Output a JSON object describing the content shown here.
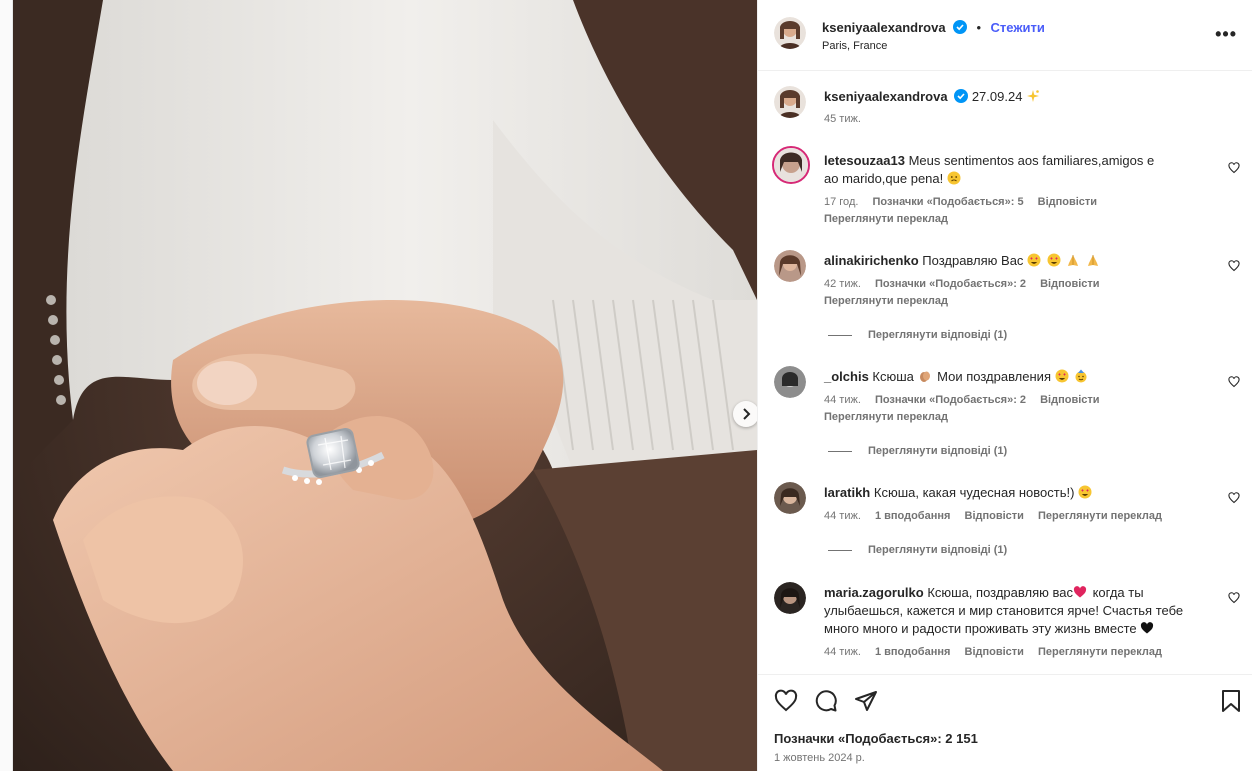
{
  "post": {
    "author": "kseniyaalexandrova",
    "follow_label": "Стежити",
    "separator": "•",
    "location": "Paris, France",
    "more_label": "•••"
  },
  "caption": {
    "author": "kseniyaalexandrova",
    "text": "27.09.24",
    "time": "45 тиж."
  },
  "comments": [
    {
      "user": "letesouzaa13",
      "text": "Meus sentimentos aos familiares,amigos e ao marido,que pena!",
      "time": "17 год.",
      "likes": "Позначки «Подобається»: 5",
      "reply": "Відповісти",
      "translate": "Переглянути переклад"
    },
    {
      "user": "alinakirichenko",
      "text": "Поздравляю Вас",
      "time": "42 тиж.",
      "likes": "Позначки «Подобається»: 2",
      "reply": "Відповісти",
      "translate": "Переглянути переклад",
      "view_replies": "Переглянути відповіді (1)"
    },
    {
      "user": "_olchis",
      "text": "Ксюша",
      "text2": "Мои поздравления",
      "time": "44 тиж.",
      "likes": "Позначки «Подобається»: 2",
      "reply": "Відповісти",
      "translate": "Переглянути переклад",
      "view_replies": "Переглянути відповіді (1)"
    },
    {
      "user": "laratikh",
      "text": "Ксюша, какая чудесная новость!)",
      "time": "44 тиж.",
      "likes": "1 вподобання",
      "reply": "Відповісти",
      "translate": "Переглянути переклад",
      "view_replies": "Переглянути відповіді (1)"
    },
    {
      "user": "maria.zagorulko",
      "text": "Ксюша, поздравляю вас",
      "text2": "когда ты улыбаешься, кажется и мир становится ярче! Счастья тебе много много и радости проживать эту жизнь вместе",
      "time": "44 тиж.",
      "likes": "1 вподобання",
      "reply": "Відповісти",
      "translate": "Переглянути переклад"
    }
  ],
  "footer": {
    "likes": "Позначки «Подобається»: 2 151",
    "date": "1 жовтень 2024 р."
  },
  "colors": {
    "accent": "#4a5df9",
    "verified": "#0095f6",
    "muted": "#737373"
  },
  "icons": {
    "like": "heart-icon",
    "comment": "comment-bubble-icon",
    "share": "paper-plane-icon",
    "save": "bookmark-icon",
    "next": "chevron-right-icon"
  }
}
